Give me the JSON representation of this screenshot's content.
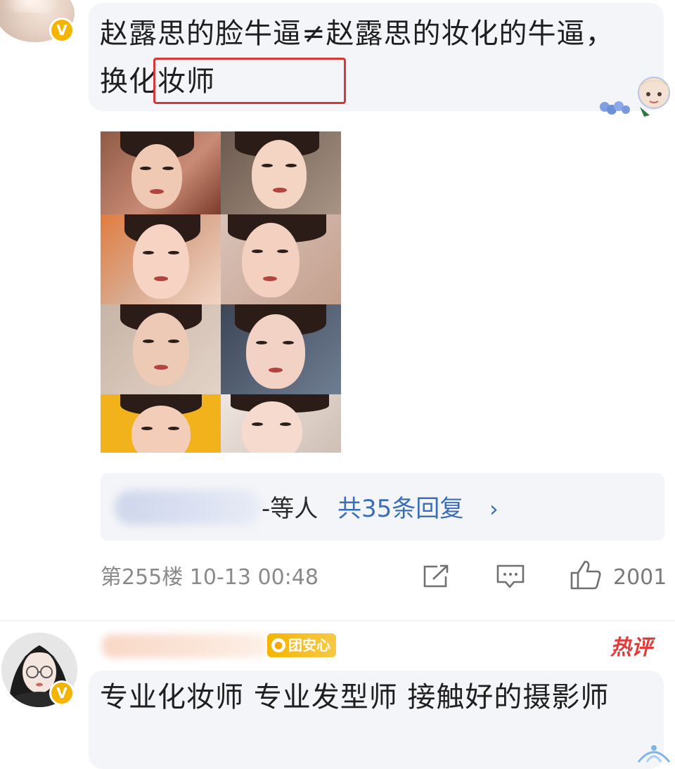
{
  "comment1": {
    "text": "赵露思的脸牛逼≠赵露思的妆化的牛逼，换化妆师",
    "highlight_text": "换化妆师",
    "verified_badge": "V",
    "replies": {
      "suffix": "-等人",
      "count_label": "共35条回复",
      "chevron": "›"
    },
    "meta": {
      "floor_time": "第255楼 10-13 00:48",
      "like_count": "2001"
    }
  },
  "comment2": {
    "fan_badge": "团安心",
    "hot_tag": "热评",
    "verified_badge": "V",
    "text": "专业化妆师 专业发型师 接触好的摄影师"
  },
  "colors": {
    "bubble_bg": "#f4f5f8",
    "link_blue": "#3a6fb7",
    "highlight_red": "#d63a37",
    "verified_gold": "#f5b400",
    "hot_red": "#e23b3b",
    "meta_gray": "#8a8a8a"
  },
  "icons": [
    "verified-badge-icon",
    "sticker-icon",
    "chevron-right-icon",
    "share-icon",
    "comment-icon",
    "thumbs-up-icon",
    "fan-badge-icon"
  ]
}
